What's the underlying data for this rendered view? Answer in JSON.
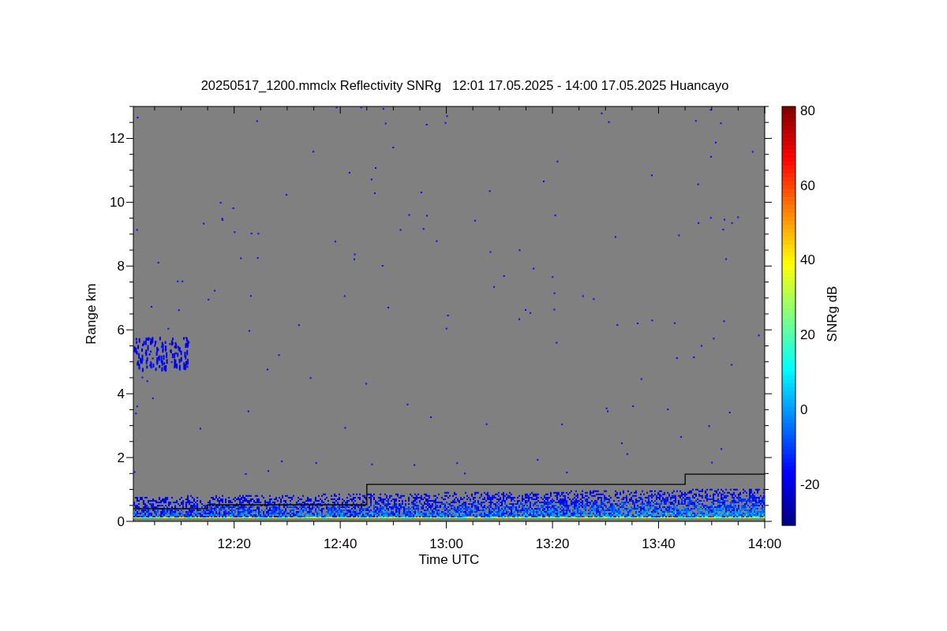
{
  "chart_data": {
    "type": "line",
    "title": "20250517_1200.mmclx Reflectivity SNRg   12:01 17.05.2025 - 14:00 17.05.2025 Huancayo",
    "xlabel": "Time UTC",
    "ylabel": "Range km",
    "x": [
      12.0167,
      12.25,
      12.25,
      12.75,
      12.75,
      13.75,
      13.75,
      14
    ],
    "series": [
      {
        "color": "#000000",
        "values": [
          0.4,
          0.4,
          0.52,
          0.52,
          1.16,
          1.16,
          1.48,
          1.48
        ]
      }
    ],
    "xlim": [
      12.0167,
      14
    ],
    "ylim": [
      0,
      13
    ],
    "xticks": [
      {
        "value": 12.3333,
        "label": "12:20"
      },
      {
        "value": 12.6667,
        "label": "12:40"
      },
      {
        "value": 13,
        "label": "13:00"
      },
      {
        "value": 13.3333,
        "label": "13:20"
      },
      {
        "value": 13.6667,
        "label": "13:40"
      },
      {
        "value": 14,
        "label": "14:00"
      }
    ],
    "yticks": [
      0,
      2,
      4,
      6,
      8,
      10,
      12
    ]
  },
  "colorbar": {
    "label": "SNRg dB",
    "ticks": [
      "80",
      "60",
      "40",
      "20",
      "0",
      "-20"
    ]
  }
}
